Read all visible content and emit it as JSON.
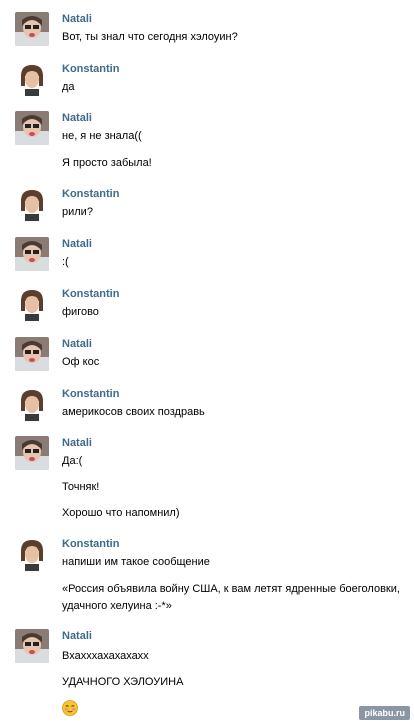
{
  "authors": {
    "natali": "Natali",
    "konstantin": "Konstantin"
  },
  "colors": {
    "author_name": "#3e6b8a",
    "text": "#000000",
    "background": "#ffffff"
  },
  "messages": [
    {
      "author": "Natali",
      "lines": [
        "Вот, ты знал что сегодня хэлоуин?"
      ]
    },
    {
      "author": "Konstantin",
      "lines": [
        "да"
      ]
    },
    {
      "author": "Natali",
      "lines": [
        "не, я не знала((",
        "Я просто забыла!"
      ]
    },
    {
      "author": "Konstantin",
      "lines": [
        "рили?"
      ]
    },
    {
      "author": "Natali",
      "lines": [
        ":("
      ]
    },
    {
      "author": "Konstantin",
      "lines": [
        "фигово"
      ]
    },
    {
      "author": "Natali",
      "lines": [
        "Оф кос"
      ]
    },
    {
      "author": "Konstantin",
      "lines": [
        "америкосов своих поздравь"
      ]
    },
    {
      "author": "Natali",
      "lines": [
        "Да:(",
        "Точняк!",
        "Хорошо что напомнил)"
      ]
    },
    {
      "author": "Konstantin",
      "lines": [
        "напиши им такое сообщение",
        "«Россия объявила войну США, к вам летят ядренные боеголовки,",
        "удачного хелуина :-*»"
      ]
    },
    {
      "author": "Natali",
      "lines": [
        "Вхахххахахахахх",
        "УДАЧНОГО ХЭЛОУИНА"
      ],
      "emoji": "blushing-smiley-icon"
    }
  ],
  "watermark": "pikabu.ru"
}
